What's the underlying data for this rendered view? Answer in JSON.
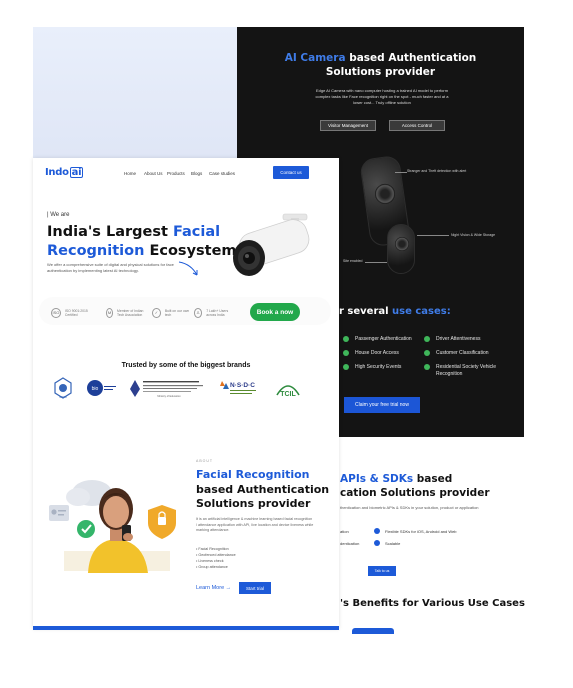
{
  "colors": {
    "brand_blue": "#1d5ad8",
    "dark_bg": "#141414",
    "accent_green": "#22a84b"
  },
  "dark_panel": {
    "title_highlight": "AI Camera",
    "title_rest_line1": "based Authentication",
    "title_line2": "Solutions provider",
    "description": "Edge AI Camera with nano computer hosting a trained AI model to perform complex tasks like Face recognition right on the spot - much faster and at a lower cost... Truly offline solution",
    "buttons": [
      "Visitor Management",
      "Access Control"
    ],
    "callouts": [
      "Stranger and Theft detection with alert",
      "Night Vision & Wide Storage",
      "Site enabled"
    ],
    "use_cases_prefix": "r several",
    "use_cases_highlight": "use cases:",
    "use_cases_left": [
      "Passenger Authentication",
      "House Door Access",
      "High Security Events"
    ],
    "use_cases_right": [
      "Driver Attentiveness",
      "Customer Classification",
      "Residential Society Vehicle Recognition"
    ],
    "cta": "Claim your free trial now"
  },
  "api_panel": {
    "title_highlight": "APIs & SDKs",
    "title_rest": "based",
    "title_line2": "cation Solutions provider",
    "description": "thentication and biometric APIs & SDKs in your solution, product or application",
    "features_left": [
      "ation",
      "dentication"
    ],
    "features_right": [
      "Flexible SDKs for iOS, Android and Web",
      "Scalable"
    ],
    "button": "Talk to us",
    "benefits_prefix": "'s Benefits for Various",
    "benefits_rest": "Use Cases"
  },
  "front": {
    "logo_text": "Indo",
    "logo_ai": "ai",
    "nav": [
      "Home",
      "About Us",
      "Products",
      "Blogs",
      "Case studies"
    ],
    "contact": "Contact us",
    "we_are": "| We are",
    "hero_line1_a": "India's Largest ",
    "hero_line1_b": "Facial",
    "hero_line2_a": "Recognition",
    "hero_line2_b": " Ecosystem",
    "hero_desc": "We offer a comprehensive suite of digital and physical solutions for face authentication by implementing latest AI technology.",
    "badges": [
      {
        "icon": "ISO",
        "text": "ISO 9001:2015 Certified"
      },
      {
        "icon": "M",
        "text": "Member of Indian Tech Association"
      },
      {
        "icon": "✓",
        "text": "Built on our own tech"
      },
      {
        "icon": "♙",
        "text": "7 Lakh+ Users across India"
      }
    ],
    "book": "Book a now",
    "trusted": "Trusted by some of the biggest brands",
    "brands": [
      "MHRD",
      "bio",
      "Ministry of Education",
      "N·S·D·C",
      "TCIL"
    ],
    "about_tag": "ABOUT",
    "sec_title_highlight": "Facial Recognition",
    "sec_title_line2": "based Authentication",
    "sec_title_line3": "Solutions provider",
    "sec_desc": "It is an artificial intelligence & machine learning based facial recognition / attendance application with API, live location and device liveness while marking attendance.",
    "bullets": [
      "Facial Recognition",
      "Geofenced attendance",
      "Liveness check",
      "Group attendance"
    ],
    "learn_more": "Learn More →",
    "start_trial": "Start trial"
  }
}
